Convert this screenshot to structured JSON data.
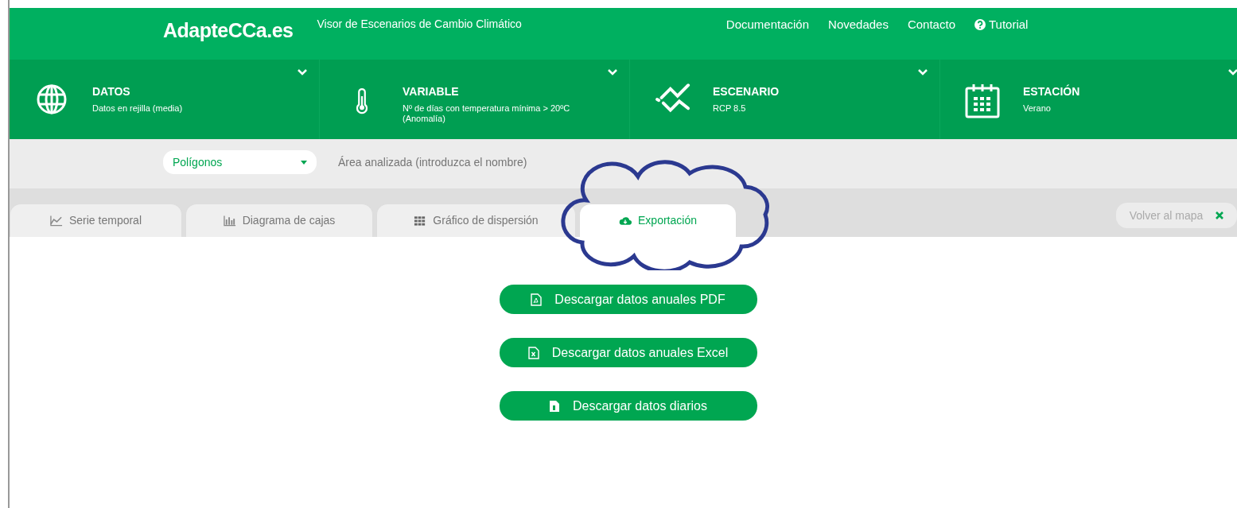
{
  "header": {
    "logo": "AdapteCCa.es",
    "subtitle": "Visor de Escenarios de Cambio Climático",
    "nav": [
      {
        "label": "Documentación",
        "kind": "link"
      },
      {
        "label": "Novedades",
        "kind": "link"
      },
      {
        "label": "Contacto",
        "kind": "link"
      },
      {
        "label": "Tutorial",
        "kind": "help"
      }
    ]
  },
  "selectors": [
    {
      "kind": "globe",
      "title": "DATOS",
      "value": "Datos en rejilla (media)"
    },
    {
      "kind": "thermometer",
      "title": "VARIABLE",
      "value": "Nº de días con temperatura mínima > 20ºC (Anomalía)"
    },
    {
      "kind": "trend",
      "title": "ESCENARIO",
      "value": "RCP 8.5"
    },
    {
      "kind": "calendar",
      "title": "ESTACIÓN",
      "value": "Verano"
    }
  ],
  "area": {
    "dropdown": "Polígonos",
    "placeholder": "Área analizada (introduzca el nombre)"
  },
  "tabs": [
    {
      "label": "Serie temporal",
      "kind": "line",
      "selected": false
    },
    {
      "label": "Diagrama de cajas",
      "kind": "bars",
      "selected": false
    },
    {
      "label": "Gráfico de dispersión",
      "kind": "grid",
      "selected": false
    },
    {
      "label": "Exportación",
      "kind": "cloud",
      "selected": true
    }
  ],
  "back_button": "Volver al mapa",
  "downloads": [
    {
      "label": "Descargar datos anuales PDF",
      "kind": "pdf"
    },
    {
      "label": "Descargar datos anuales Excel",
      "kind": "excel"
    },
    {
      "label": "Descargar datos diarios",
      "kind": "daily"
    }
  ]
}
